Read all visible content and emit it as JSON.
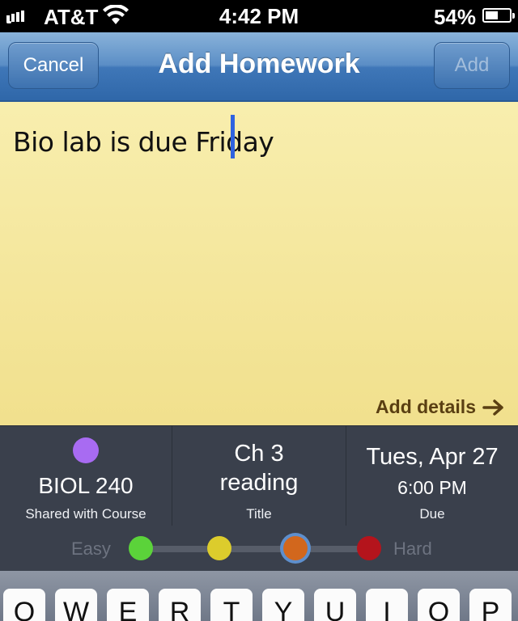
{
  "status_bar": {
    "carrier": "AT&T",
    "time": "4:42 PM",
    "battery_text": "54%",
    "battery_level": 0.54,
    "icons": [
      "signal-icon",
      "wifi-icon",
      "battery-icon"
    ]
  },
  "nav": {
    "cancel_label": "Cancel",
    "title": "Add Homework",
    "add_label": "Add",
    "bar_color": "#4a80bf"
  },
  "note": {
    "text": "Bio lab is due Friday",
    "add_details_label": "Add details",
    "background": "#f4e597",
    "cursor_color": "#2f63e0"
  },
  "details": {
    "course": {
      "name": "BIOL 240",
      "caption": "Shared with Course",
      "color": "#a86bf2"
    },
    "title": {
      "line1": "Ch 3",
      "line2": "reading",
      "caption": "Title"
    },
    "due": {
      "date": "Tues, Apr 27",
      "time": "6:00 PM",
      "caption": "Due"
    }
  },
  "difficulty": {
    "easy_label": "Easy",
    "hard_label": "Hard",
    "levels": [
      {
        "name": "easy",
        "color": "#5bd33a"
      },
      {
        "name": "medium-easy",
        "color": "#dccc2c"
      },
      {
        "name": "medium-hard",
        "color": "#d2671d"
      },
      {
        "name": "hard",
        "color": "#b4141c"
      }
    ],
    "selected_level": 3
  },
  "keyboard": {
    "keys": [
      "Q",
      "W",
      "E",
      "R",
      "T",
      "Y",
      "U",
      "I",
      "O",
      "P"
    ]
  }
}
